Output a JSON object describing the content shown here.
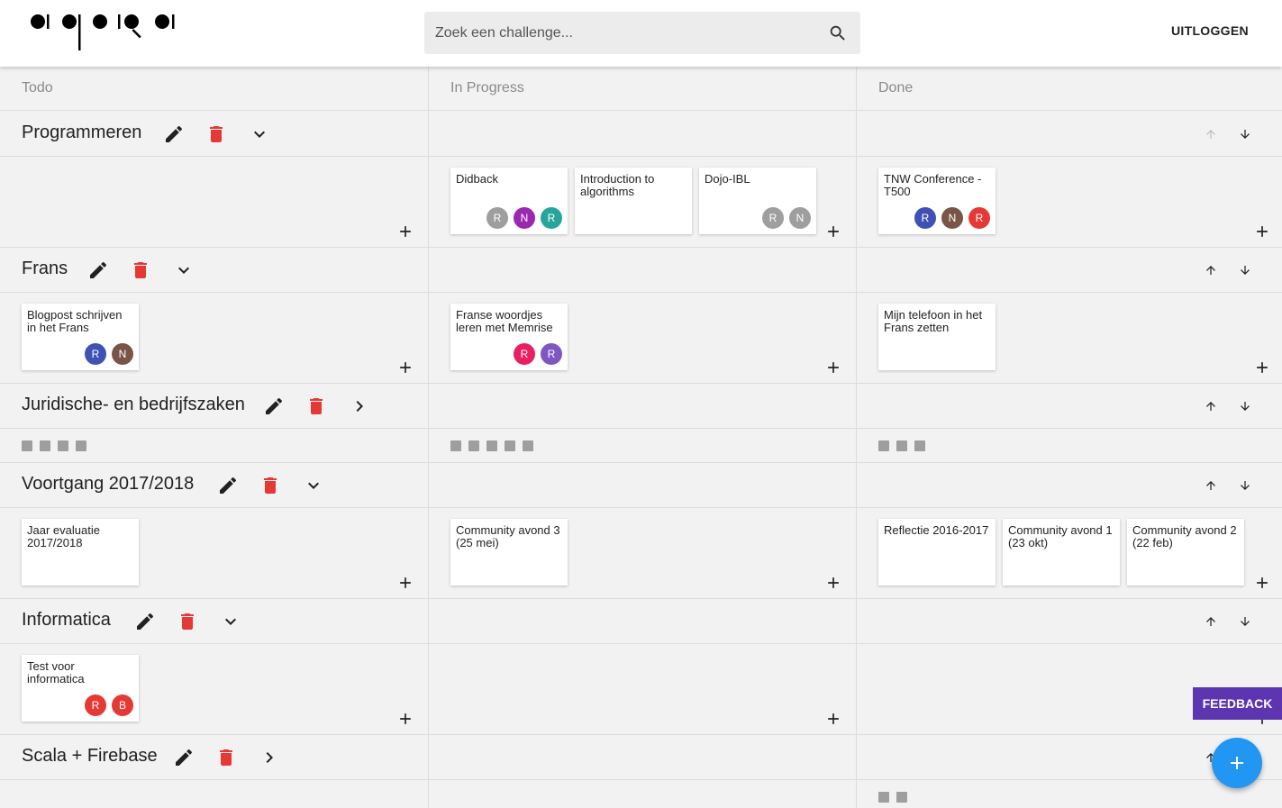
{
  "header": {
    "search_placeholder": "Zoek een challenge...",
    "logout_label": "UITLOGGEN"
  },
  "columns": [
    "Todo",
    "In Progress",
    "Done"
  ],
  "categories": [
    {
      "title": "Programmeren",
      "todo": [],
      "in_progress": [
        {
          "title": "Didback",
          "avatars": [
            "R",
            "N",
            "R"
          ]
        },
        {
          "title": "Introduction to algorithms",
          "avatars": []
        },
        {
          "title": "Dojo-IBL",
          "avatars": [
            "R",
            "N"
          ]
        }
      ],
      "done": [
        {
          "title": "TNW Conference - T500",
          "avatars": [
            "R",
            "N",
            "R"
          ]
        }
      ]
    },
    {
      "title": "Frans",
      "todo": [
        {
          "title": "Blogpost schrijven in het Frans",
          "avatars": [
            "R",
            "N"
          ]
        }
      ],
      "in_progress": [
        {
          "title": "Franse woordjes leren met Memrise",
          "avatars": [
            "R",
            "R"
          ]
        }
      ],
      "done": [
        {
          "title": "Mijn telefoon in het Frans zetten",
          "avatars": []
        }
      ]
    },
    {
      "title": "Juridische- en bedrijfszaken",
      "collapsed_counts": [
        4,
        5,
        3
      ]
    },
    {
      "title": "Voortgang 2017/2018",
      "todo": [
        {
          "title": "Jaar evaluatie 2017/2018",
          "avatars": []
        }
      ],
      "in_progress": [
        {
          "title": "Community avond 3 (25 mei)",
          "avatars": []
        }
      ],
      "done": [
        {
          "title": "Reflectie 2016-2017",
          "avatars": []
        },
        {
          "title": "Community avond 1 (23 okt)",
          "avatars": []
        },
        {
          "title": "Community avond 2 (22 feb)",
          "avatars": []
        }
      ]
    },
    {
      "title": "Informatica",
      "todo": [
        {
          "title": "Test voor informatica",
          "avatars": [
            "R",
            "B"
          ]
        }
      ],
      "in_progress": [],
      "done": []
    },
    {
      "title": "Scala + Firebase",
      "collapsed_counts": [
        0,
        0,
        2
      ]
    }
  ],
  "avatar_colors": {
    "grey": "#9e9e9e",
    "purple": "#9c27b0",
    "teal": "#26a69a",
    "indigo": "#3f51b5",
    "brown": "#795548",
    "red": "#e53935",
    "pink": "#e91e63",
    "deep_purple": "#7e57c2"
  },
  "feedback_label": "FEEDBACK",
  "colors": {
    "accent_fab": "#2196f3",
    "feedback": "#5e35b1",
    "delete_red": "#e53935"
  }
}
